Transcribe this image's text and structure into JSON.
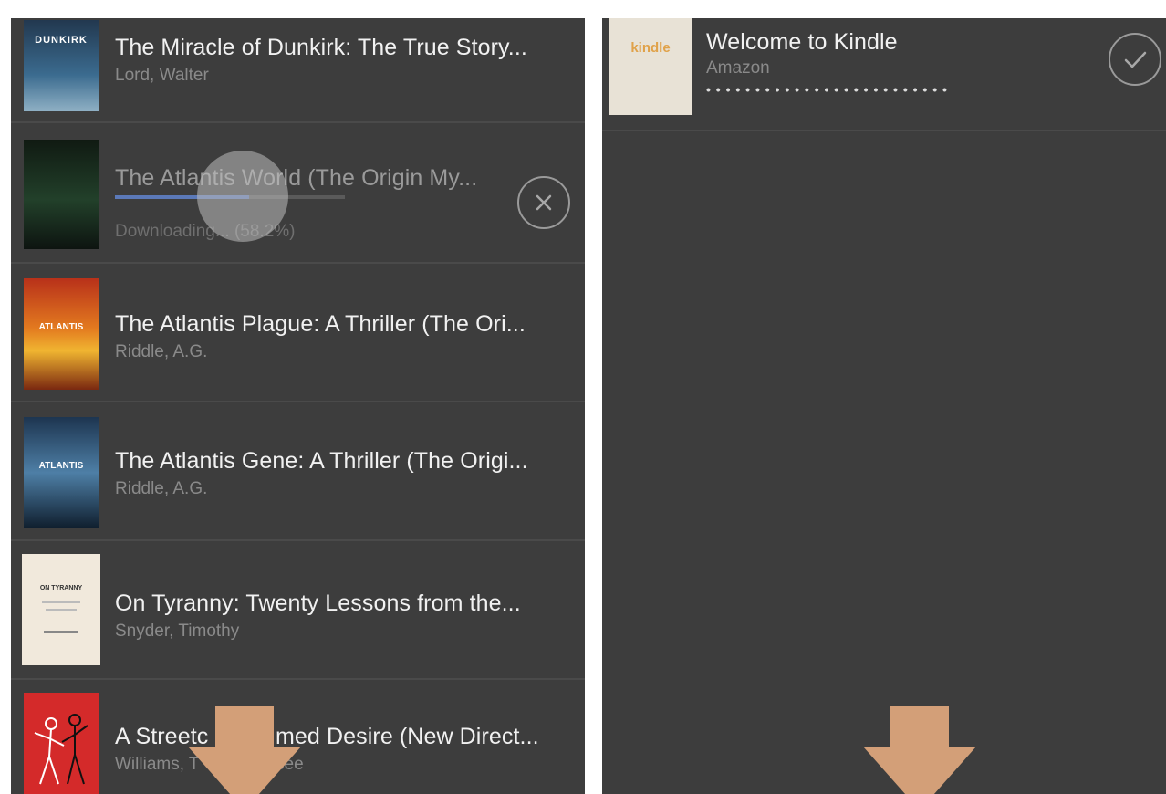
{
  "left_list": {
    "items": [
      {
        "title": "The Miracle of Dunkirk: The True Story...",
        "author": "Lord, Walter",
        "cover_text": "DUNKIRK",
        "cover_color": "#2d4a66"
      },
      {
        "title": "The Atlantis World (The Origin My...",
        "status": "Downloading... (58.2%)",
        "progress": 0.582,
        "cover_color": "#1a2a1c"
      },
      {
        "title": "The Atlantis Plague: A Thriller (The Ori...",
        "author": "Riddle, A.G.",
        "cover_text": "ATLANTIS",
        "cover_color": "#c54a1a"
      },
      {
        "title": "The Atlantis Gene: A Thriller (The Origi...",
        "author": "Riddle, A.G.",
        "cover_text": "ATLANTIS",
        "cover_color": "#2c4f6e"
      },
      {
        "title": "On Tyranny: Twenty Lessons from the...",
        "author": "Snyder, Timothy",
        "cover_text": "ON TYRANNY",
        "cover_color": "#f1e9dc"
      },
      {
        "title": "A Streetc",
        "title_tail": "med Desire (New Direct...",
        "author": "Williams, T",
        "author_tail": "see",
        "cover_color": "#d42a2a"
      }
    ],
    "cancel_icon": "close-circle-icon"
  },
  "right_list": {
    "items": [
      {
        "title": "Welcome to Kindle",
        "author": "Amazon",
        "cover_text": "kindle",
        "cover_color": "#e8e2d6",
        "dots": "• • • • • • • • • • • • • • • • • • • • • • • • •",
        "check_icon": "check-circle-icon"
      }
    ]
  },
  "overlays": {
    "arrow_icon": "down-arrow-icon",
    "arrow_color": "#d39f78"
  }
}
